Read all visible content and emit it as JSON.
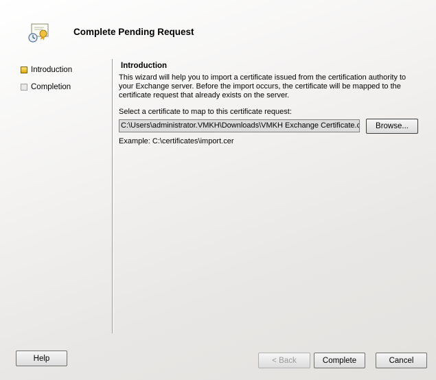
{
  "header": {
    "title": "Complete Pending Request",
    "icon": "certificate-icon"
  },
  "steps": [
    {
      "label": "Introduction",
      "state": "active"
    },
    {
      "label": "Completion",
      "state": "inactive"
    }
  ],
  "content": {
    "section_title": "Introduction",
    "description": "This wizard will help you to import a certificate issued from the certification authority to your Exchange server. Before the import occurs, the certificate will be mapped to the certificate request that already exists on the server.",
    "select_label": "Select a certificate to map to this certificate request:",
    "path_value": "C:\\Users\\administrator.VMKH\\Downloads\\VMKH Exchange Certificate.cer",
    "browse_label": "Browse...",
    "example": "Example: C:\\certificates\\import.cer"
  },
  "footer": {
    "help_label": "Help",
    "back_label": "< Back",
    "complete_label": "Complete",
    "cancel_label": "Cancel"
  },
  "colors": {
    "active_step": "#f0c020",
    "inactive_step": "#e0e0e0",
    "divider": "#9a9a9a"
  }
}
